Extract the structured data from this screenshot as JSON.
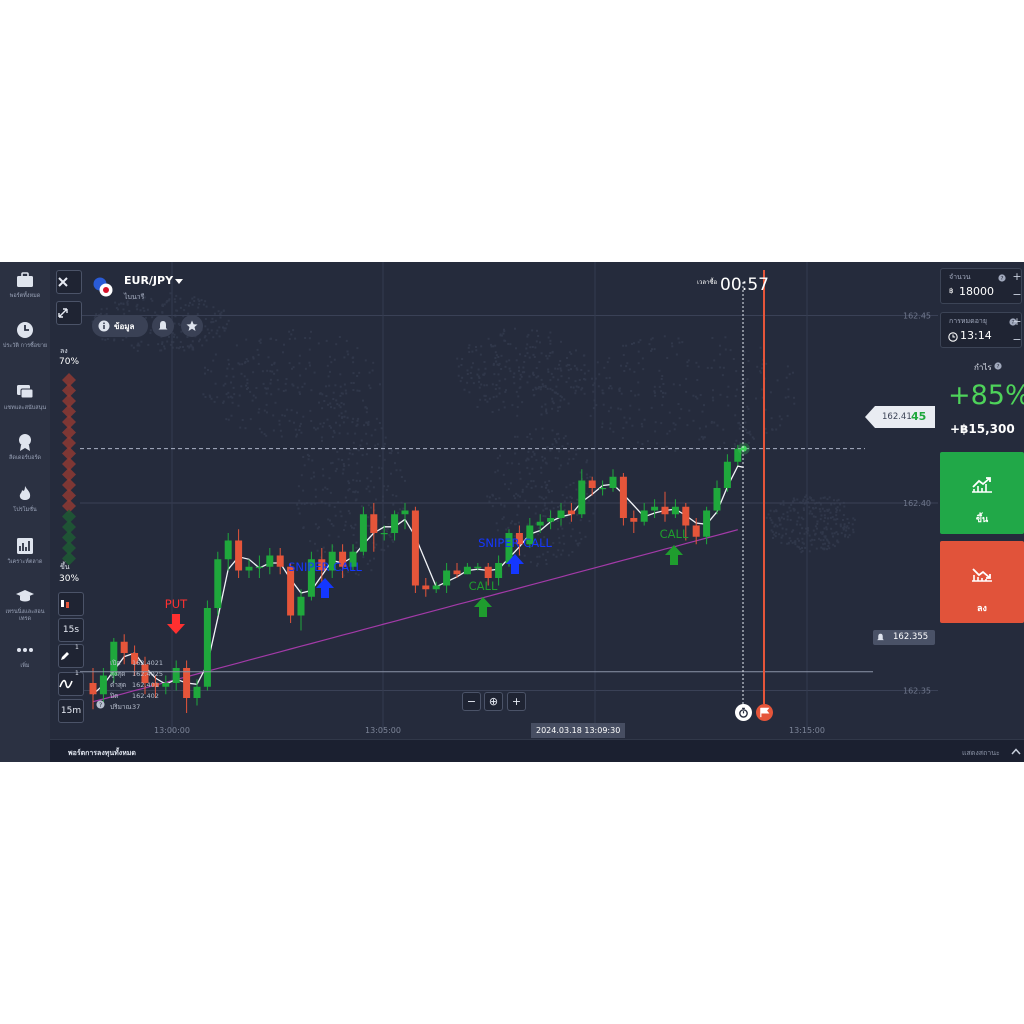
{
  "nav": {
    "items": [
      {
        "label": "พอร์ตทั้งหมด",
        "icon": "briefcase-icon"
      },
      {
        "label": "ประวัติ การซื้อขาย",
        "icon": "clock-icon"
      },
      {
        "label": "แชทและสนับสนุน",
        "icon": "chat-icon"
      },
      {
        "label": "ลีดเดอร์บอร์ด",
        "icon": "trophy-icon"
      },
      {
        "label": "โปรโมชั่น",
        "icon": "fire-icon"
      },
      {
        "label": "วิเคราะห์ตลาด",
        "icon": "analytics-icon"
      },
      {
        "label": "เทรนนิ่งและสอนเทรด",
        "icon": "education-icon"
      },
      {
        "label": "เพิ่ม",
        "icon": "more-icon"
      }
    ]
  },
  "asset": {
    "name": "EUR/JPY",
    "type": "ไบนารี"
  },
  "toolbar": {
    "info_label": "ข้อมูล"
  },
  "sentiment": {
    "down_label": "ลง",
    "down_pct": "70%",
    "up_label": "ขึ้น",
    "up_pct": "30%"
  },
  "timer": {
    "label": "เวลาซื้อ",
    "value": "00:57"
  },
  "price": {
    "current_main": "162.41",
    "current_tail": "45",
    "alert_price": "162.355",
    "levels": [
      "162.45",
      "162.40",
      "162.35"
    ]
  },
  "ohlc": {
    "rows": [
      {
        "label": "เปิด",
        "value": "162.4021"
      },
      {
        "label": "สูงสุด",
        "value": "162.4025"
      },
      {
        "label": "ต่ำสุด",
        "value": "162.401"
      },
      {
        "label": "ปิด",
        "value": "162.402"
      },
      {
        "label": "ปริมาณ",
        "value": "37"
      }
    ]
  },
  "chart_tools": {
    "timeframe_a": "15s",
    "timeframe_b": "15m",
    "badge": "1"
  },
  "signals": [
    {
      "text": "PUT",
      "color": "#ff3030"
    },
    {
      "text": "SNIPER CALL",
      "color": "#1437ff"
    },
    {
      "text": "SNIPER CALL",
      "color": "#1437ff"
    },
    {
      "text": "CALL",
      "color": "#1f9d2e"
    },
    {
      "text": "CALL",
      "color": "#1f9d2e"
    }
  ],
  "time_axis": {
    "ticks": [
      "13:00:00",
      "13:05:00",
      "13:15:00"
    ],
    "cursor_time": "2024.03.18 13:09:30"
  },
  "zoom": {
    "minus": "−",
    "center": "⊕",
    "plus": "+"
  },
  "panel": {
    "amount_label": "จำนวน",
    "amount_currency": "฿",
    "amount_value": "18000",
    "expiry_label": "การหมดอายุ",
    "expiry_value": "13:14",
    "profit_label": "กำไร",
    "profit_pct": "+85%",
    "profit_amount": "+฿15,300",
    "up_label": "ขึ้น",
    "down_label": "ลง"
  },
  "bottom": {
    "left_label": "พอร์ตการลงทุนทั้งหมด",
    "right_label": "แสดงสถานะ"
  },
  "colors": {
    "up": "#1fa83c",
    "down": "#e5553a",
    "call_btn": "#21a848",
    "put_btn": "#e1533a",
    "profit": "#4ed35a"
  },
  "candles": [
    [
      162.352,
      162.349,
      162.356,
      162.345
    ],
    [
      162.349,
      162.354,
      162.356,
      162.347
    ],
    [
      162.354,
      162.363,
      162.364,
      162.352
    ],
    [
      162.363,
      162.36,
      162.365,
      162.357
    ],
    [
      162.36,
      162.357,
      162.362,
      162.354
    ],
    [
      162.357,
      162.352,
      162.359,
      162.349
    ],
    [
      162.352,
      162.351,
      162.354,
      162.348
    ],
    [
      162.351,
      162.352,
      162.354,
      162.349
    ],
    [
      162.352,
      162.356,
      162.358,
      162.35
    ],
    [
      162.356,
      162.348,
      162.358,
      162.344
    ],
    [
      162.348,
      162.351,
      162.353,
      162.346
    ],
    [
      162.351,
      162.372,
      162.374,
      162.35
    ],
    [
      162.372,
      162.385,
      162.387,
      162.37
    ],
    [
      162.385,
      162.39,
      162.392,
      162.382
    ],
    [
      162.39,
      162.382,
      162.393,
      162.38
    ],
    [
      162.382,
      162.383,
      162.385,
      162.38
    ],
    [
      162.383,
      162.383,
      162.386,
      162.38
    ],
    [
      162.383,
      162.386,
      162.388,
      162.381
    ],
    [
      162.386,
      162.383,
      162.388,
      162.381
    ],
    [
      162.383,
      162.37,
      162.384,
      162.368
    ],
    [
      162.37,
      162.375,
      162.377,
      162.366
    ],
    [
      162.375,
      162.385,
      162.387,
      162.374
    ],
    [
      162.385,
      162.382,
      162.388,
      162.379
    ],
    [
      162.382,
      162.387,
      162.389,
      162.38
    ],
    [
      162.387,
      162.383,
      162.389,
      162.38
    ],
    [
      162.383,
      162.387,
      162.389,
      162.382
    ],
    [
      162.387,
      162.397,
      162.399,
      162.386
    ],
    [
      162.397,
      162.392,
      162.4,
      162.387
    ],
    [
      162.392,
      162.392,
      162.394,
      162.39
    ],
    [
      162.392,
      162.397,
      162.398,
      162.39
    ],
    [
      162.397,
      162.398,
      162.4,
      162.393
    ],
    [
      162.398,
      162.378,
      162.399,
      162.376
    ],
    [
      162.378,
      162.377,
      162.38,
      162.375
    ],
    [
      162.377,
      162.378,
      162.379,
      162.376
    ],
    [
      162.378,
      162.382,
      162.384,
      162.376
    ],
    [
      162.382,
      162.381,
      162.384,
      162.38
    ],
    [
      162.381,
      162.383,
      162.384,
      162.381
    ],
    [
      162.383,
      162.383,
      162.384,
      162.382
    ],
    [
      162.383,
      162.38,
      162.384,
      162.378
    ],
    [
      162.38,
      162.384,
      162.386,
      162.378
    ],
    [
      162.384,
      162.392,
      162.393,
      162.383
    ],
    [
      162.392,
      162.389,
      162.394,
      162.386
    ],
    [
      162.389,
      162.394,
      162.396,
      162.388
    ],
    [
      162.394,
      162.395,
      162.397,
      162.392
    ],
    [
      162.395,
      162.396,
      162.398,
      162.393
    ],
    [
      162.396,
      162.398,
      162.4,
      162.394
    ],
    [
      162.398,
      162.397,
      162.4,
      162.395
    ],
    [
      162.397,
      162.406,
      162.409,
      162.396
    ],
    [
      162.406,
      162.404,
      162.407,
      162.402
    ],
    [
      162.404,
      162.404,
      162.406,
      162.402
    ],
    [
      162.404,
      162.407,
      162.409,
      162.403
    ],
    [
      162.407,
      162.396,
      162.408,
      162.394
    ],
    [
      162.396,
      162.395,
      162.398,
      162.392
    ],
    [
      162.395,
      162.398,
      162.4,
      162.394
    ],
    [
      162.398,
      162.399,
      162.401,
      162.396
    ],
    [
      162.399,
      162.397,
      162.403,
      162.395
    ],
    [
      162.397,
      162.399,
      162.401,
      162.396
    ],
    [
      162.399,
      162.394,
      162.4,
      162.39
    ],
    [
      162.394,
      162.391,
      162.396,
      162.389
    ],
    [
      162.391,
      162.398,
      162.399,
      162.389
    ],
    [
      162.398,
      162.404,
      162.406,
      162.397
    ],
    [
      162.404,
      162.411,
      162.413,
      162.403
    ],
    [
      162.411,
      162.4145,
      162.4155,
      162.41
    ]
  ]
}
